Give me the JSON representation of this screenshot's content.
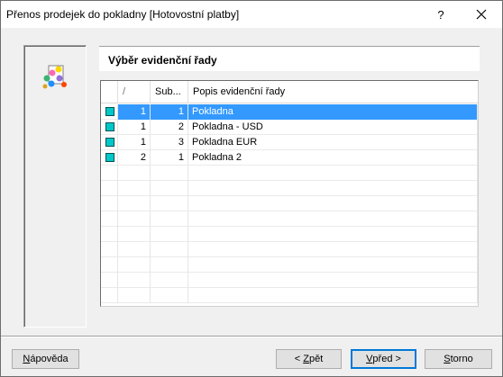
{
  "window": {
    "title": "Přenos prodejek do pokladny [Hotovostní platby]",
    "help_label": "?"
  },
  "section": {
    "title": "Výběr evidenční řady"
  },
  "grid": {
    "columns": {
      "num": "/",
      "sub": "Sub...",
      "desc": "Popis evidenční řady"
    },
    "rows": [
      {
        "num": "1",
        "sub": "1",
        "desc": "Pokladna",
        "selected": true
      },
      {
        "num": "1",
        "sub": "2",
        "desc": "Pokladna - USD",
        "selected": false
      },
      {
        "num": "1",
        "sub": "3",
        "desc": "Pokladna EUR",
        "selected": false
      },
      {
        "num": "2",
        "sub": "1",
        "desc": "Pokladna 2",
        "selected": false
      }
    ],
    "marker_color": "#00c8c8",
    "selection_color": "#3399ff"
  },
  "buttons": {
    "help": {
      "pre": "",
      "mn": "N",
      "post": "ápověda"
    },
    "back": {
      "pre": "< ",
      "mn": "Z",
      "post": "pět"
    },
    "next": {
      "pre": "",
      "mn": "V",
      "post": "před >"
    },
    "cancel": {
      "pre": "",
      "mn": "S",
      "post": "torno"
    }
  }
}
